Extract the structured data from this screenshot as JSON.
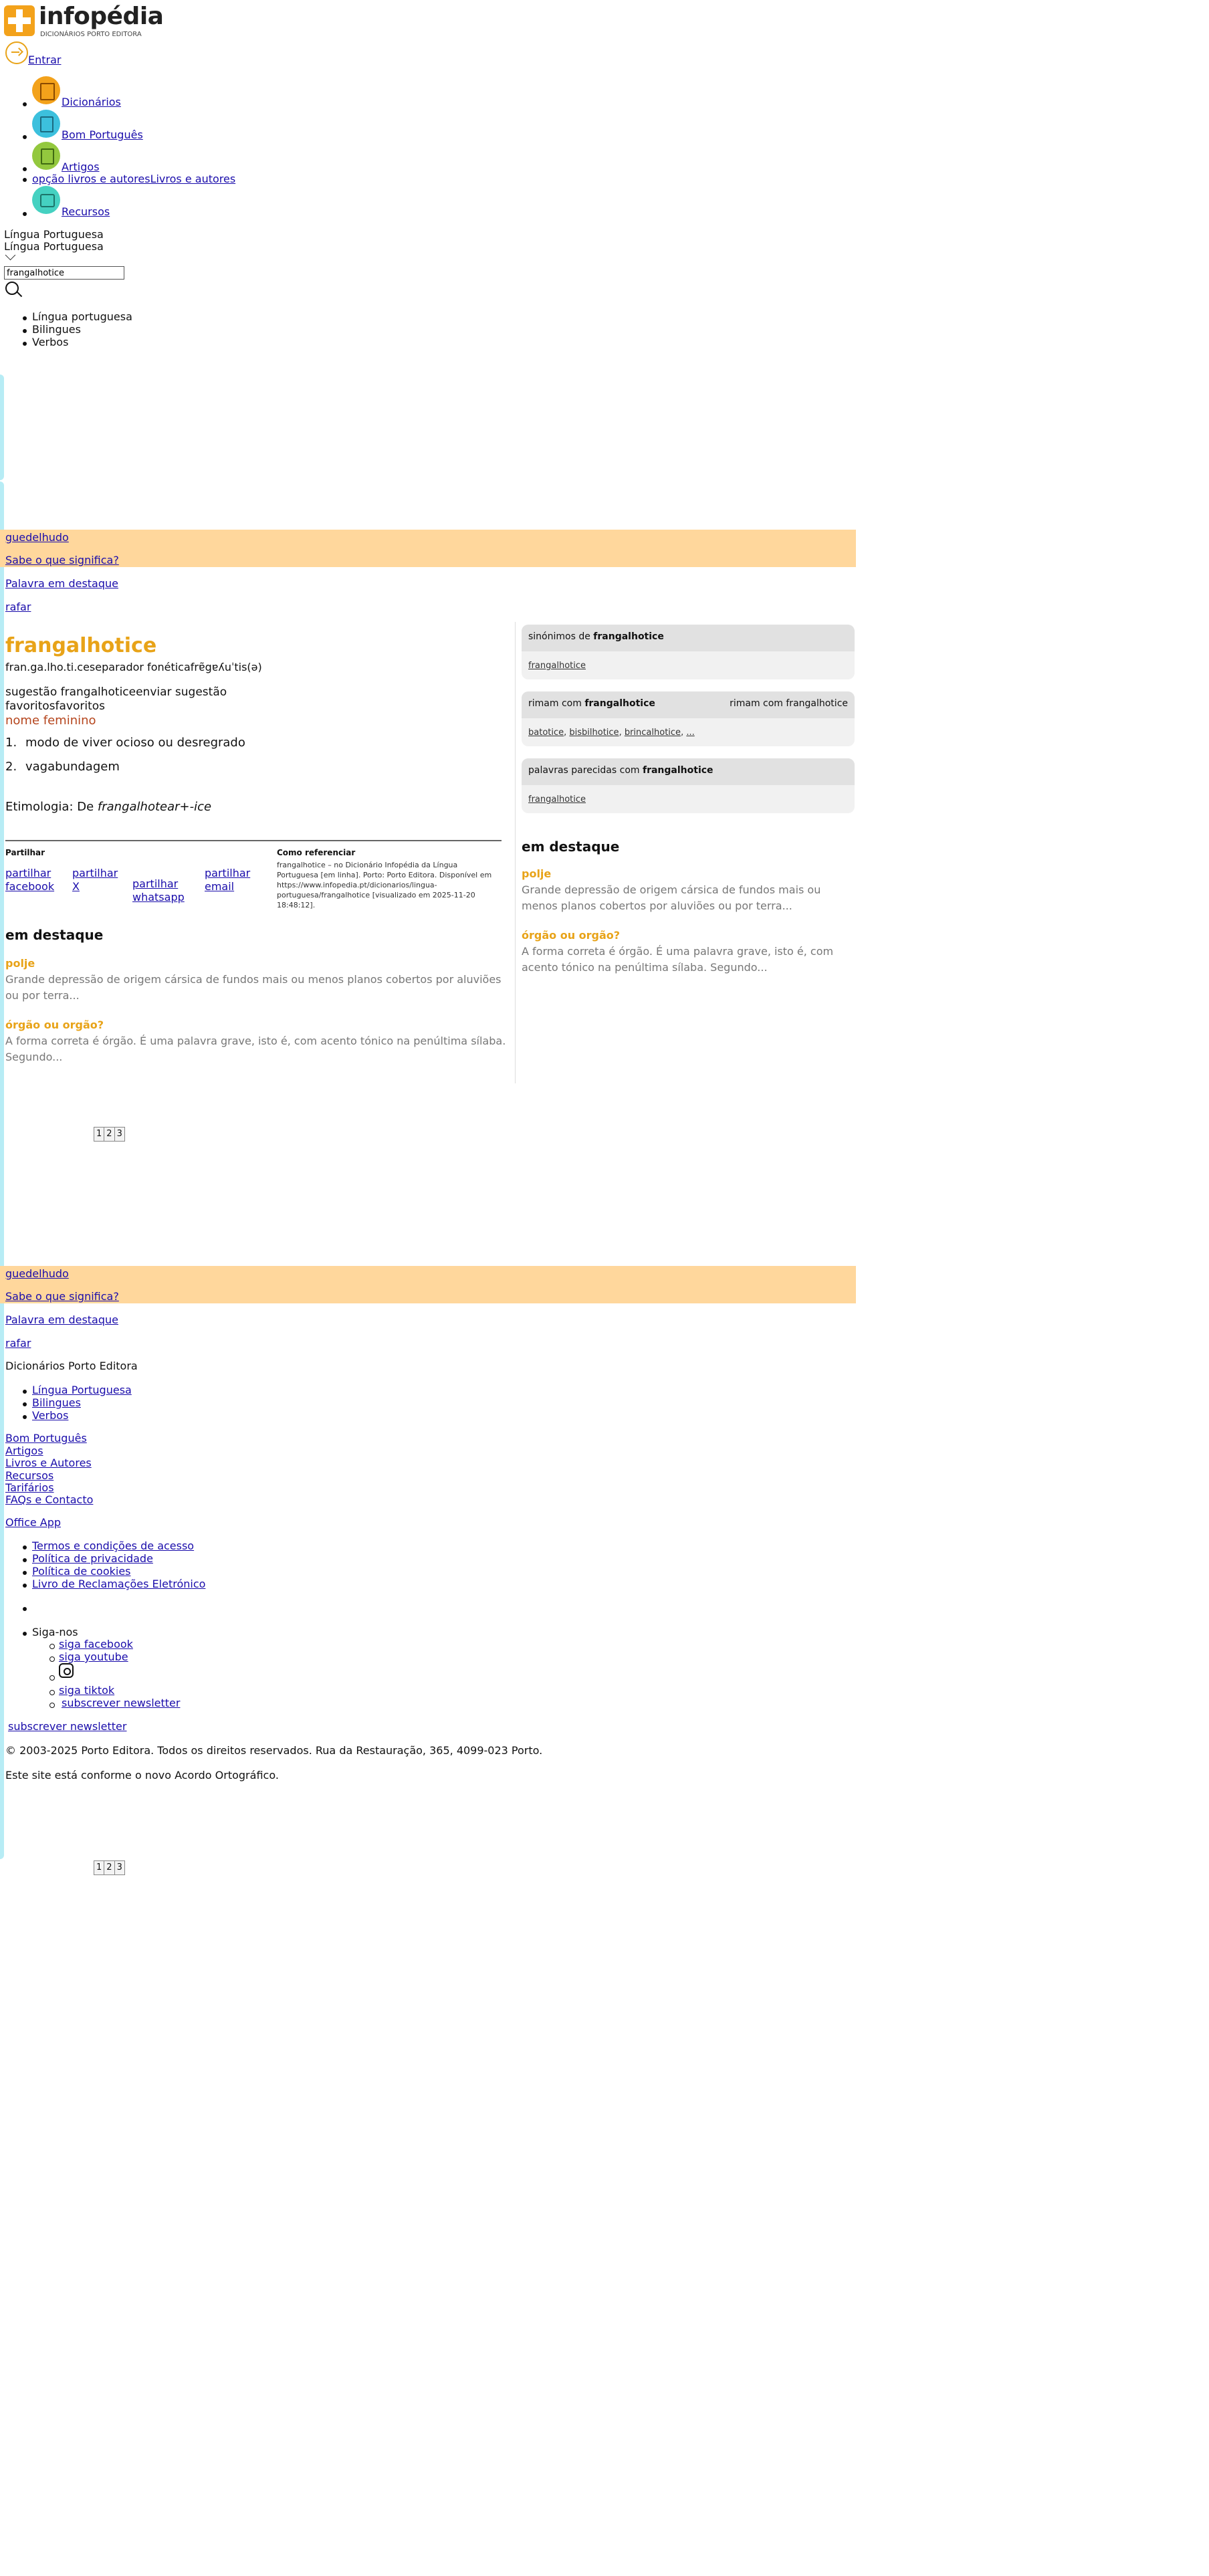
{
  "header": {
    "logo_text": "infopédia",
    "logo_sub": "DICIONÁRIOS PORTO EDITORA",
    "login": "Entrar"
  },
  "nav": {
    "items": [
      {
        "label": "Dicionários",
        "color": "#f3a21b"
      },
      {
        "label": "Bom Português",
        "color": "#3cc0dd"
      },
      {
        "label": "Artigos",
        "color": "#93c83e"
      },
      {
        "label": "Livros e autores",
        "alt": "opção livros e autores"
      },
      {
        "label": "Recursos",
        "color": "#45d1c1"
      }
    ]
  },
  "search": {
    "language": "Língua Portuguesa",
    "language_repeat": "Língua Portuguesa",
    "value": "frangalhotice",
    "options": [
      "Língua portuguesa",
      "Bilingues",
      "Verbos"
    ]
  },
  "promo": {
    "word": "guedelhudo",
    "question": "Sabe o que significa?",
    "highlight_label": "Palavra em destaque",
    "highlight_word": "rafar"
  },
  "entry": {
    "word": "frangalhotice",
    "syllables": "fran.ga.lho.ti.ce",
    "separator_alt": "separador fonética",
    "phonetic": "frɐ̃gɐʎuˈtis(ə)",
    "suggest_alt": "sugestão frangalhotice",
    "suggest_label": "enviar sugestão",
    "fav_alt": "favoritos",
    "fav_label": "favoritos",
    "pos": "nome feminino",
    "senses": [
      {
        "n": "1.",
        "text": "modo de viver ocioso ou desregrado"
      },
      {
        "n": "2.",
        "text": "vagabundagem"
      }
    ],
    "etymology_prefix": "Etimologia: De ",
    "etymology_italic": "frangalhotear+-ice"
  },
  "share": {
    "title": "Partilhar",
    "buttons": [
      "partilhar facebook",
      "partilhar X",
      "partilhar whatsapp",
      "partilhar email"
    ],
    "ref_title": "Como referenciar",
    "ref_lines": [
      "frangalhotice – no Dicionário Infopédia da Língua",
      "Portuguesa [em linha]. Porto: Porto Editora. Disponível em",
      "https://www.infopedia.pt/dicionarios/lingua-",
      "portuguesa/frangalhotice [visualizado em 2025-11-20",
      "18:48:12]."
    ]
  },
  "featured": {
    "title": "em destaque",
    "items": [
      {
        "title": "polje",
        "lines": [
          "Grande depressão de origem cársica de fundos mais ou menos planos cobertos por aluviões",
          "ou por terra..."
        ]
      },
      {
        "title": "órgão ou orgão?",
        "lines": [
          "A forma correta é órgão. É uma palavra grave, isto é, com acento tónico na penúltima sílaba.",
          "Segundo..."
        ]
      }
    ]
  },
  "sidebar": {
    "synonyms_prefix": "sinónimos de ",
    "synonyms_word": "frangalhotice",
    "synonyms": [
      "frangalhotice"
    ],
    "rhymes_prefix": "rimam com ",
    "rhymes_word": "frangalhotice",
    "rhymes_alt": "rimam com frangalhotice",
    "rhymes": [
      "batotice",
      "bisbilhotice",
      "brincalhotice"
    ],
    "rhymes_more": "...",
    "similar_prefix": "palavras parecidas com ",
    "similar_word": "frangalhotice",
    "similar": [
      "frangalhotice"
    ],
    "featured_items": [
      {
        "title": "polje",
        "lines": [
          "Grande depressão de origem cársica de fundos mais ou",
          "menos planos cobertos por aluviões ou por terra..."
        ]
      },
      {
        "title": "órgão ou orgão?",
        "lines": [
          "A forma correta é órgão. É uma palavra grave, isto é, com",
          "acento tónico na penúltima sílaba. Segundo..."
        ]
      }
    ]
  },
  "pager": [
    "1",
    "2",
    "3"
  ],
  "footer": {
    "brand": "Dicionários Porto Editora",
    "dict_links": [
      "Língua Portuguesa",
      "Bilingues",
      "Verbos"
    ],
    "links": [
      "Bom Português",
      "Artigos",
      "Livros e Autores",
      "Recursos",
      "Tarifários",
      "FAQs e Contacto"
    ],
    "office_app": "Office App",
    "legal": [
      "Termos e condições de acesso",
      "Política de privacidade",
      "Política de cookies",
      "Livro de Reclamações Eletrónico"
    ],
    "follow": "Siga-nos",
    "social": {
      "facebook": "siga facebook",
      "youtube": "siga youtube",
      "tiktok": "siga tiktok",
      "newsletter": "subscrever newsletter"
    },
    "newsletter_link": "subscrever newsletter",
    "copyright": "© 2003-2025 Porto Editora. Todos os direitos reservados. Rua da Restauração, 365, 4099-023 Porto.",
    "agreement": "Este site está conforme o novo Acordo Ortográfico."
  },
  "colors": {
    "accent": "#e8a318",
    "band": "#ffd79c",
    "sidebar_bar": "#b7ecf5",
    "pos": "#b5451d"
  }
}
